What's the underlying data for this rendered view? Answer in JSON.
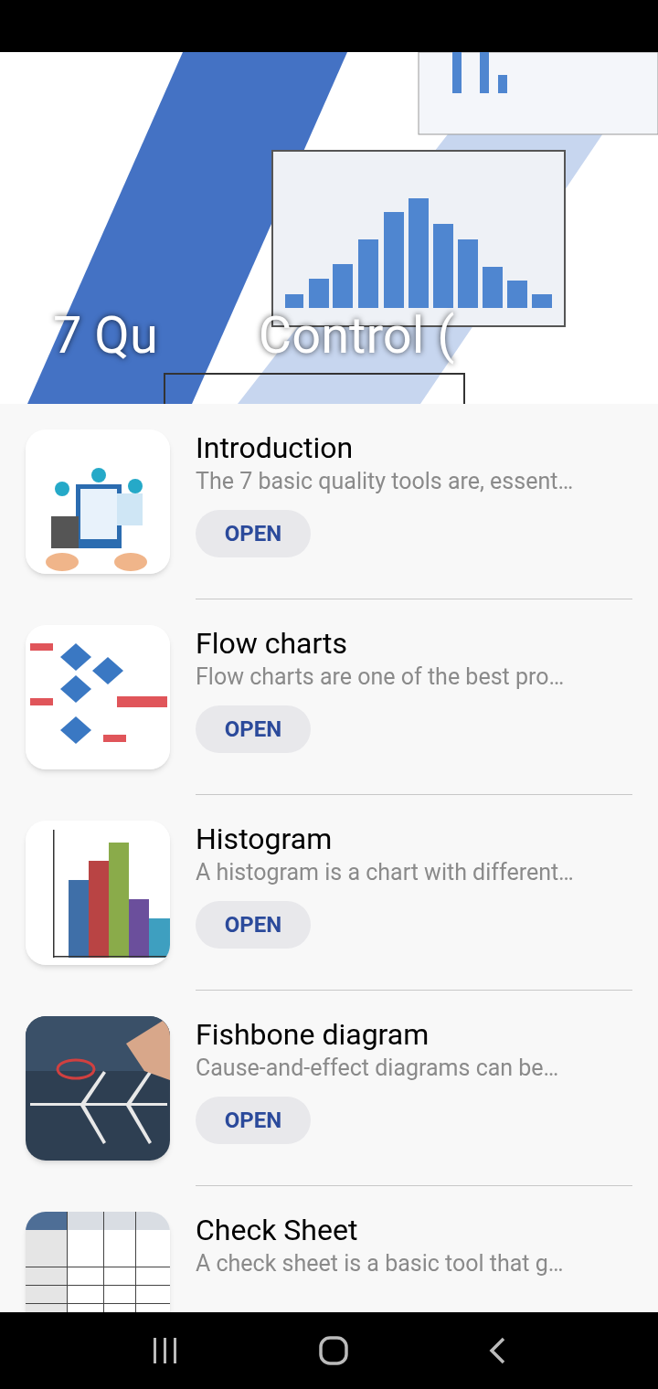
{
  "header": {
    "kind": "picture",
    "title_parts": [
      "7 Qu",
      "Control ("
    ]
  },
  "items": [
    {
      "title": "Introduction",
      "description": "The 7 basic quality tools are, essent…",
      "button": "OPEN"
    },
    {
      "title": "Flow charts",
      "description": "Flow charts are one of the best pro…",
      "button": "OPEN"
    },
    {
      "title": "Histogram",
      "description": "A histogram is a chart with different…",
      "button": "OPEN"
    },
    {
      "title": "Fishbone diagram",
      "description": "Cause-and-effect diagrams can be…",
      "button": "OPEN"
    },
    {
      "title": "Check Sheet",
      "description": "A check sheet is a basic tool that g…"
    }
  ]
}
